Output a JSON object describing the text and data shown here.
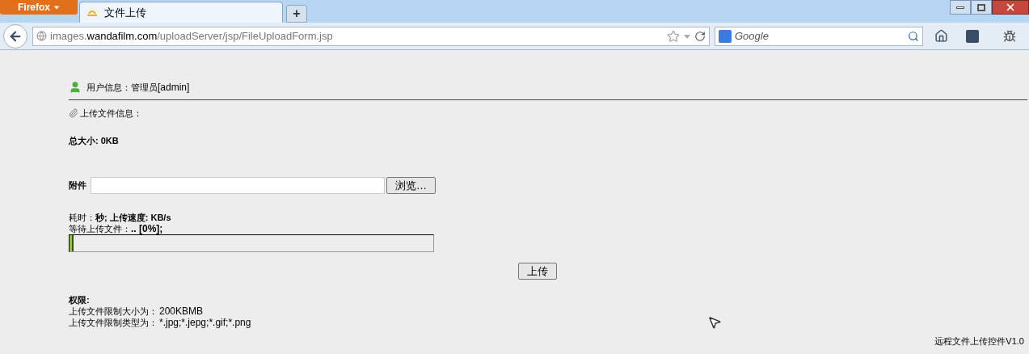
{
  "browser": {
    "menu_button": "Firefox",
    "tabs": [
      {
        "title": "文件上传",
        "selected": true
      }
    ],
    "new_tab": "+",
    "url": {
      "host": "images.",
      "domain": "wandafilm.com",
      "path": "/uploadServer/jsp/FileUploadForm.jsp"
    },
    "search": {
      "placeholder": "Google"
    }
  },
  "user_info": {
    "label": "用户信息：管理员",
    "name": "[admin]"
  },
  "upload_info": "上传文件信息：",
  "total_size": "总大小: 0KB",
  "attachment": {
    "label": "附件",
    "browse": "浏览…"
  },
  "stats": {
    "time_label": "耗时：",
    "time_rest": "秒; 上传速度:  KB/s",
    "wait_label": "等待上传文件：",
    "wait_rest": ".. [0%];"
  },
  "progress": {
    "level": 0.01
  },
  "upload_button": "上传",
  "permissions": {
    "title": "权限:",
    "rows": [
      {
        "label": "上传文件限制大小为：",
        "value": "200KBMB"
      },
      {
        "label": "上传文件限制类型为：",
        "value": "*.jpg;*.jepg;*.gif;*.png"
      }
    ]
  },
  "footer": "远程文件上传控件V1.0"
}
